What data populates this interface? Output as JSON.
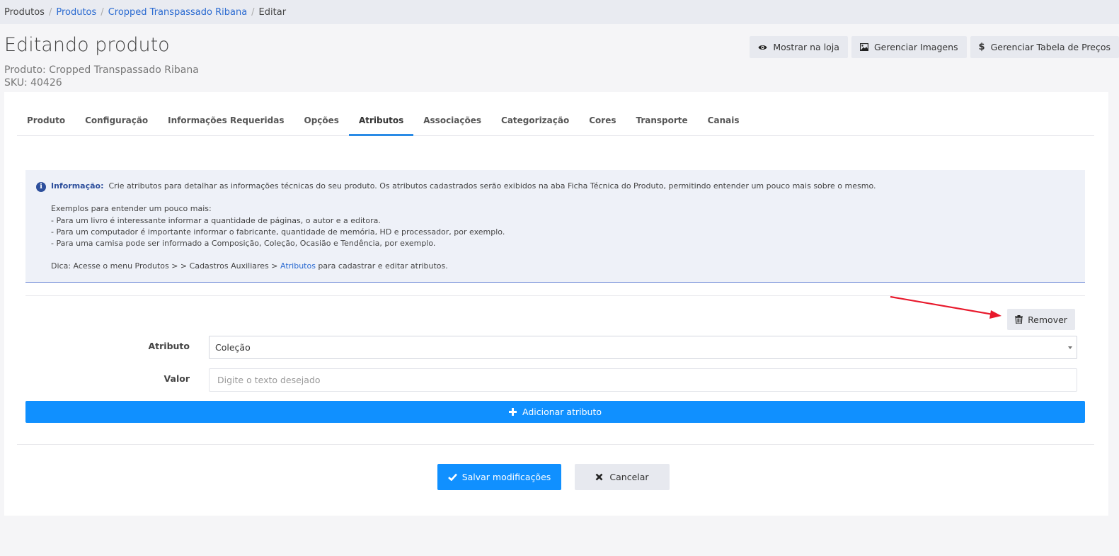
{
  "breadcrumb": {
    "root": "Produtos",
    "items": [
      "Produtos",
      "Cropped Transpassado Ribana"
    ],
    "current": "Editar"
  },
  "header": {
    "title": "Editando produto",
    "product_line": "Produto: Cropped Transpassado Ribana",
    "sku_line": "SKU: 40426",
    "actions": {
      "show_store": "Mostrar na loja",
      "manage_images": "Gerenciar Imagens",
      "manage_prices": "Gerenciar Tabela de Preços"
    }
  },
  "tabs": [
    {
      "label": "Produto"
    },
    {
      "label": "Configuração"
    },
    {
      "label": "Informações Requeridas"
    },
    {
      "label": "Opções"
    },
    {
      "label": "Atributos"
    },
    {
      "label": "Associações"
    },
    {
      "label": "Categorização"
    },
    {
      "label": "Cores"
    },
    {
      "label": "Transporte"
    },
    {
      "label": "Canais"
    }
  ],
  "active_tab": "Atributos",
  "info": {
    "label": "Informação:",
    "text": "Crie atributos para detalhar as informações técnicas do seu produto. Os atributos cadastrados serão exibidos na aba Ficha Técnica do Produto, permitindo entender um pouco mais sobre o mesmo.",
    "examples_title": "Exemplos para entender um pouco mais:",
    "examples": [
      "- Para um livro é interessante informar a quantidade de páginas, o autor e a editora.",
      "- Para um computador é importante informar o fabricante, quantidade de memória, HD e processador, por exemplo.",
      "- Para uma camisa pode ser informado a Composição, Coleção, Ocasião e Tendência, por exemplo."
    ],
    "tip_prefix": "Dica: Acesse o menu Produtos > > Cadastros Auxiliares > ",
    "tip_link": "Atributos",
    "tip_suffix": " para cadastrar e editar atributos."
  },
  "attribute_form": {
    "remove_label": "Remover",
    "attribute_label": "Atributo",
    "attribute_value": "Coleção",
    "value_label": "Valor",
    "value_placeholder": "Digite o texto desejado",
    "add_label": "Adicionar atributo"
  },
  "footer": {
    "save_label": "Salvar modificações",
    "cancel_label": "Cancelar"
  },
  "colors": {
    "primary": "#1090ff",
    "annotation_arrow": "#e8192c"
  }
}
